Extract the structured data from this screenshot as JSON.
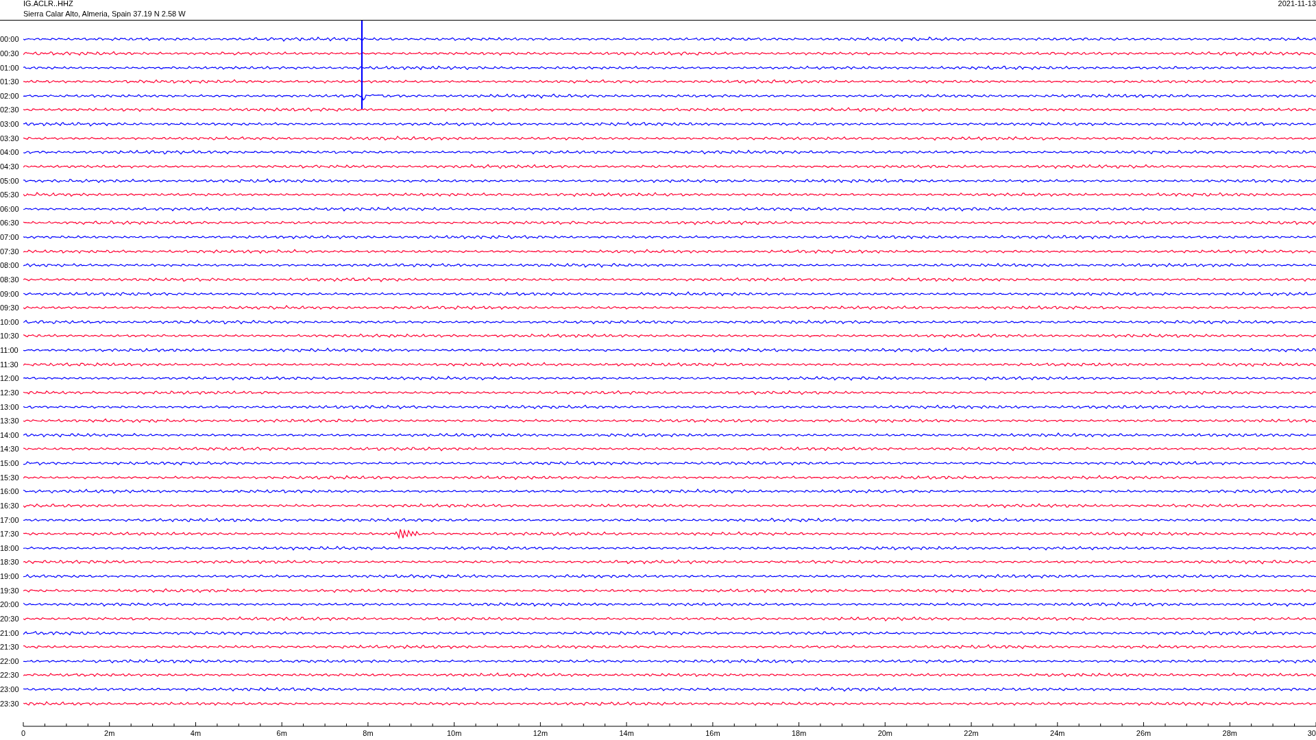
{
  "header": {
    "station": "IG.ACLR..HHZ",
    "location": "Sierra Calar Alto, Almeria, Spain  37.19 N 2.58 W",
    "date": "2021-11-13"
  },
  "traces": [
    {
      "label": "00:00",
      "color": "#0000ff",
      "kind": "normal"
    },
    {
      "label": "00:30",
      "color": "#ff0033",
      "kind": "normal"
    },
    {
      "label": "01:00",
      "color": "#0000ff",
      "kind": "normal"
    },
    {
      "label": "01:30",
      "color": "#ff0033",
      "kind": "normal"
    },
    {
      "label": "02:00",
      "color": "#0000ff",
      "kind": "spike"
    },
    {
      "label": "02:30",
      "color": "#ff0033",
      "kind": "normal"
    },
    {
      "label": "03:00",
      "color": "#0000ff",
      "kind": "normal"
    },
    {
      "label": "03:30",
      "color": "#ff0033",
      "kind": "normal"
    },
    {
      "label": "04:00",
      "color": "#0000ff",
      "kind": "normal"
    },
    {
      "label": "04:30",
      "color": "#ff0033",
      "kind": "normal"
    },
    {
      "label": "05:00",
      "color": "#0000ff",
      "kind": "normal"
    },
    {
      "label": "05:30",
      "color": "#ff0033",
      "kind": "normal"
    },
    {
      "label": "06:00",
      "color": "#0000ff",
      "kind": "normal"
    },
    {
      "label": "06:30",
      "color": "#ff0033",
      "kind": "normal"
    },
    {
      "label": "07:00",
      "color": "#0000ff",
      "kind": "normal"
    },
    {
      "label": "07:30",
      "color": "#ff0033",
      "kind": "normal"
    },
    {
      "label": "08:00",
      "color": "#0000ff",
      "kind": "normal"
    },
    {
      "label": "08:30",
      "color": "#ff0033",
      "kind": "normal"
    },
    {
      "label": "09:00",
      "color": "#0000ff",
      "kind": "normal"
    },
    {
      "label": "09:30",
      "color": "#ff0033",
      "kind": "normal"
    },
    {
      "label": "10:00",
      "color": "#0000ff",
      "kind": "normal"
    },
    {
      "label": "10:30",
      "color": "#ff0033",
      "kind": "normal"
    },
    {
      "label": "11:00",
      "color": "#0000ff",
      "kind": "normal"
    },
    {
      "label": "11:30",
      "color": "#ff0033",
      "kind": "normal"
    },
    {
      "label": "12:00",
      "color": "#0000ff",
      "kind": "normal"
    },
    {
      "label": "12:30",
      "color": "#ff0033",
      "kind": "normal"
    },
    {
      "label": "13:00",
      "color": "#0000ff",
      "kind": "normal"
    },
    {
      "label": "13:30",
      "color": "#ff0033",
      "kind": "normal"
    },
    {
      "label": "14:00",
      "color": "#0000ff",
      "kind": "normal"
    },
    {
      "label": "14:30",
      "color": "#ff0033",
      "kind": "normal"
    },
    {
      "label": "15:00",
      "color": "#0000ff",
      "kind": "normal"
    },
    {
      "label": "15:30",
      "color": "#ff0033",
      "kind": "normal"
    },
    {
      "label": "16:00",
      "color": "#0000ff",
      "kind": "normal"
    },
    {
      "label": "16:30",
      "color": "#ff0033",
      "kind": "normal"
    },
    {
      "label": "17:00",
      "color": "#0000ff",
      "kind": "normal"
    },
    {
      "label": "17:30",
      "color": "#ff0033",
      "kind": "burst"
    },
    {
      "label": "18:00",
      "color": "#0000ff",
      "kind": "normal"
    },
    {
      "label": "18:30",
      "color": "#ff0033",
      "kind": "normal"
    },
    {
      "label": "19:00",
      "color": "#0000ff",
      "kind": "normal"
    },
    {
      "label": "19:30",
      "color": "#ff0033",
      "kind": "normal"
    },
    {
      "label": "20:00",
      "color": "#0000ff",
      "kind": "normal"
    },
    {
      "label": "20:30",
      "color": "#ff0033",
      "kind": "normal"
    },
    {
      "label": "21:00",
      "color": "#0000ff",
      "kind": "normal"
    },
    {
      "label": "21:30",
      "color": "#ff0033",
      "kind": "normal"
    },
    {
      "label": "22:00",
      "color": "#0000ff",
      "kind": "normal"
    },
    {
      "label": "22:30",
      "color": "#ff0033",
      "kind": "normal"
    },
    {
      "label": "23:00",
      "color": "#0000ff",
      "kind": "normal"
    },
    {
      "label": "23:30",
      "color": "#ff0033",
      "kind": "normal"
    }
  ],
  "x_axis": {
    "ticks": [
      "0",
      "2m",
      "4m",
      "6m",
      "8m",
      "10m",
      "12m",
      "14m",
      "16m",
      "18m",
      "20m",
      "22m",
      "24m",
      "26m",
      "28m",
      "30"
    ]
  }
}
